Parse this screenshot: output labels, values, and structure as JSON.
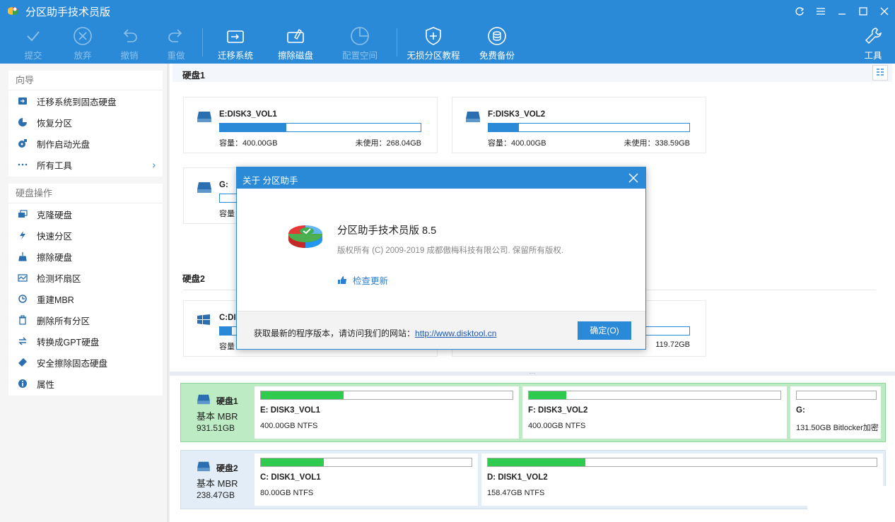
{
  "window": {
    "title": "分区助手技术员版",
    "controls": [
      "refresh",
      "menu",
      "minimize",
      "maximize",
      "close"
    ]
  },
  "toolbar": {
    "buttons": [
      {
        "label": "提交",
        "icon": "check-icon",
        "enabled": false
      },
      {
        "label": "放弃",
        "icon": "cancel-icon",
        "enabled": false
      },
      {
        "label": "撤销",
        "icon": "undo-icon",
        "enabled": false
      },
      {
        "label": "重做",
        "icon": "redo-icon",
        "enabled": false
      },
      {
        "label": "迁移系统",
        "icon": "migrate-icon",
        "enabled": true
      },
      {
        "label": "擦除磁盘",
        "icon": "wipe-disk-icon",
        "enabled": true
      },
      {
        "label": "配置空间",
        "icon": "allocate-icon",
        "enabled": false
      },
      {
        "label": "无损分区教程",
        "icon": "shield-icon",
        "enabled": true
      },
      {
        "label": "免费备份",
        "icon": "backup-icon",
        "enabled": true
      },
      {
        "label": "工具",
        "icon": "wrench-icon",
        "enabled": true
      }
    ]
  },
  "sidebar": {
    "wizard": {
      "title": "向导",
      "items": [
        {
          "label": "迁移系统到固态硬盘",
          "icon": "migrate-ssd-icon"
        },
        {
          "label": "恢复分区",
          "icon": "recover-partition-icon"
        },
        {
          "label": "制作启动光盘",
          "icon": "boot-disc-icon"
        },
        {
          "label": "所有工具",
          "icon": "all-tools-icon"
        }
      ]
    },
    "disk_ops": {
      "title": "硬盘操作",
      "items": [
        {
          "label": "克隆硬盘",
          "icon": "clone-disk-icon"
        },
        {
          "label": "快速分区",
          "icon": "lightning-icon"
        },
        {
          "label": "擦除硬盘",
          "icon": "broom-icon"
        },
        {
          "label": "检测坏扇区",
          "icon": "scan-sector-icon"
        },
        {
          "label": "重建MBR",
          "icon": "rebuild-mbr-icon"
        },
        {
          "label": "删除所有分区",
          "icon": "trash-icon"
        },
        {
          "label": "转换成GPT硬盘",
          "icon": "convert-icon"
        },
        {
          "label": "安全擦除固态硬盘",
          "icon": "eraser-icon"
        },
        {
          "label": "属性",
          "icon": "info-icon"
        }
      ]
    }
  },
  "main": {
    "disk1_title": "硬盘1",
    "disk2_title": "硬盘2",
    "cards": [
      {
        "name": "E:DISK3_VOL1",
        "capacity": "容量：400.00GB",
        "free": "未使用：268.04GB",
        "used_ratio": 0.33
      },
      {
        "name": "F:DISK3_VOL2",
        "capacity": "容量：400.00GB",
        "free": "未使用：338.59GB",
        "used_ratio": 0.15
      },
      {
        "name": "G:",
        "capacity": "容量",
        "free": "",
        "used_ratio": 0
      },
      {
        "name": "C:DIS",
        "capacity": "容量",
        "free": "",
        "used_ratio": 0.06
      },
      {
        "name": "",
        "capacity": "",
        "free": "119.72GB",
        "used_ratio": 0
      }
    ]
  },
  "bottom": {
    "disks": [
      {
        "name": "硬盘1",
        "type": "基本 MBR",
        "size": "931.51GB",
        "partitions": [
          {
            "name": "E: DISK3_VOL1",
            "info": "400.00GB NTFS",
            "used_ratio": 0.33
          },
          {
            "name": "F: DISK3_VOL2",
            "info": "400.00GB NTFS",
            "used_ratio": 0.15
          },
          {
            "name": "G:",
            "info": "131.50GB Bitlocker加密",
            "used_ratio": 0
          }
        ]
      },
      {
        "name": "硬盘2",
        "type": "基本 MBR",
        "size": "238.47GB",
        "partitions": [
          {
            "name": "C: DISK1_VOL1",
            "info": "80.00GB NTFS",
            "used_ratio": 0.3
          },
          {
            "name": "D: DISK1_VOL2",
            "info": "158.47GB NTFS",
            "used_ratio": 0.25
          }
        ]
      }
    ]
  },
  "dialog": {
    "title": "关于 分区助手",
    "product": "分区助手技术员版 8.5",
    "copyright": "版权所有 (C) 2009-2019 成都傲梅科技有限公司. 保留所有版权.",
    "update_link": "检查更新",
    "footer_text": "获取最新的程序版本，请访问我们的网站：",
    "footer_url": "http://www.disktool.cn",
    "ok_label": "确定(O)"
  },
  "colors": {
    "accent": "#2b8ad7",
    "used_bar": "#2fcb4f",
    "selected_row": "#bdebc4"
  }
}
